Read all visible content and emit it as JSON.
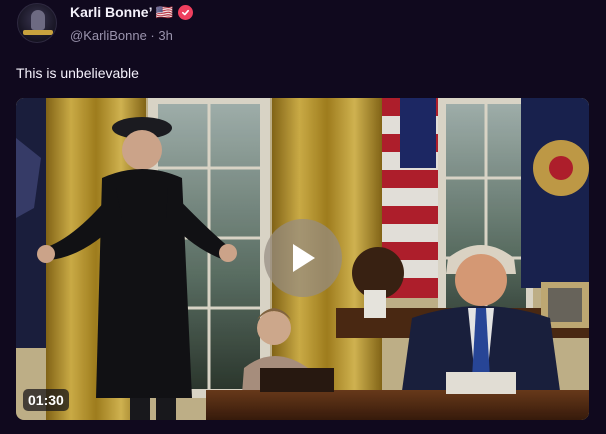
{
  "author": {
    "display_name": "Karli Bonne’ 🇺🇸",
    "handle": "@KarliBonne",
    "separator": "·",
    "time_ago": "3h",
    "verified": true,
    "avatar_icon": "profile-photo",
    "verified_icon": "verified-check-badge-icon"
  },
  "post": {
    "text": "This is unbelievable"
  },
  "media": {
    "type": "video",
    "scene": "oval-office-photo",
    "duration": "01:30",
    "play_icon": "play-icon"
  },
  "colors": {
    "background": "#10091e",
    "primary_text": "#f4f1fb",
    "secondary_text": "#9a93ad",
    "verified_badge": "#ef3f5e",
    "play_overlay": "#968c82"
  }
}
